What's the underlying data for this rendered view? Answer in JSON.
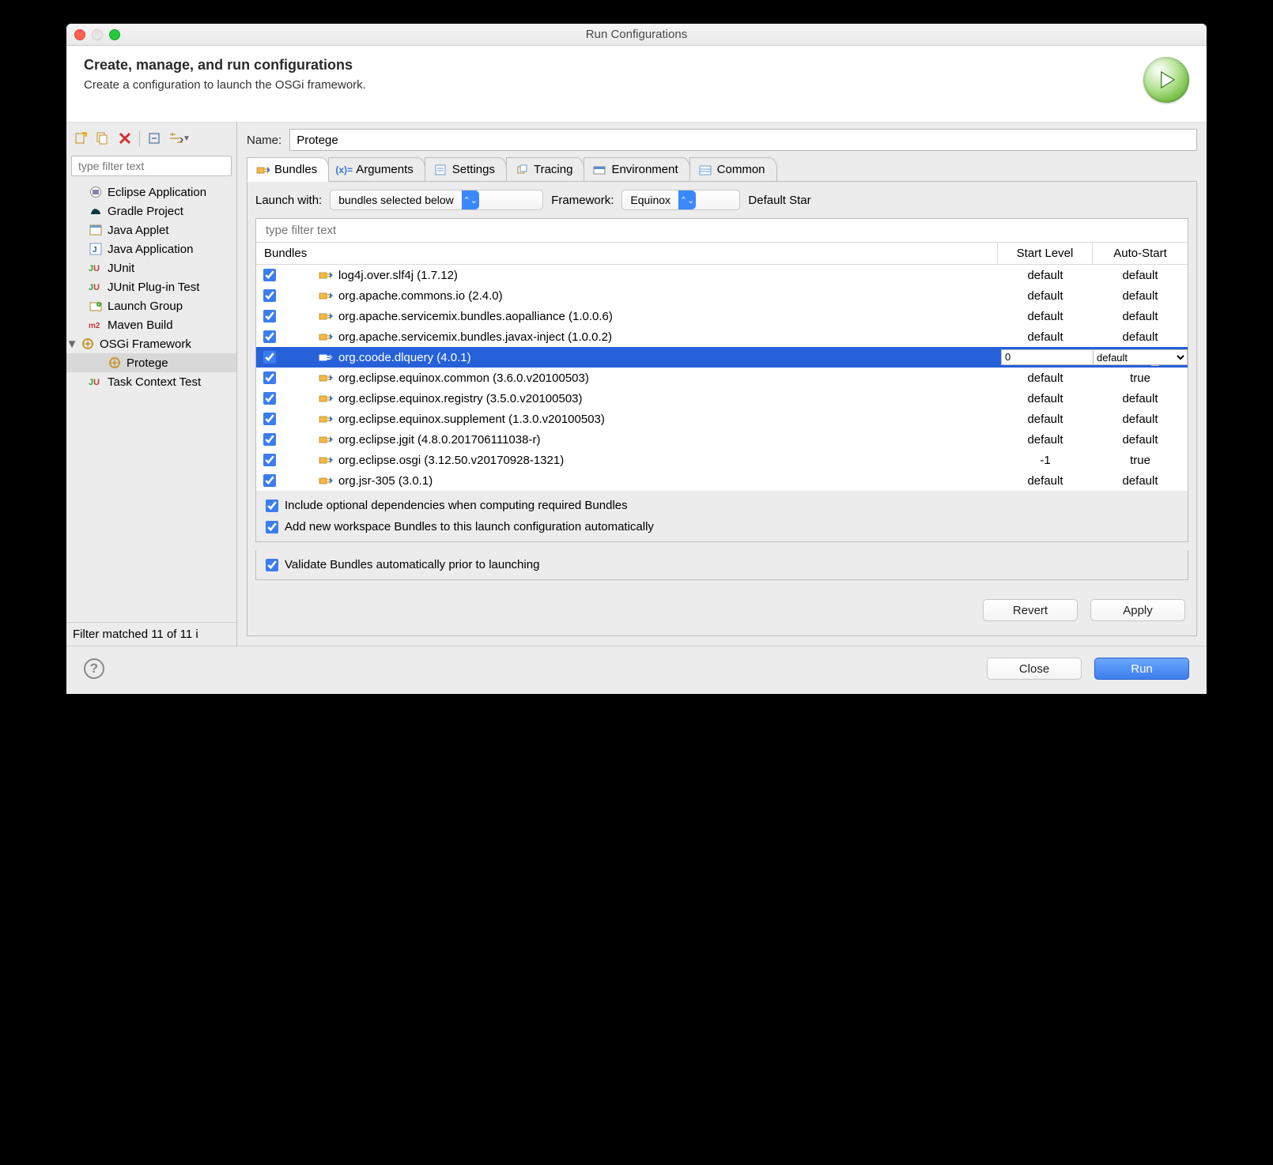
{
  "window": {
    "title": "Run Configurations"
  },
  "header": {
    "title": "Create, manage, and run configurations",
    "subtitle": "Create a configuration to launch the OSGi framework."
  },
  "sidebar": {
    "filter_placeholder": "type filter text",
    "items": [
      {
        "label": "Eclipse Application",
        "icon": "eclipse"
      },
      {
        "label": "Gradle Project",
        "icon": "gradle"
      },
      {
        "label": "Java Applet",
        "icon": "applet"
      },
      {
        "label": "Java Application",
        "icon": "java"
      },
      {
        "label": "JUnit",
        "icon": "junit"
      },
      {
        "label": "JUnit Plug-in Test",
        "icon": "junit"
      },
      {
        "label": "Launch Group",
        "icon": "launch-group"
      },
      {
        "label": "Maven Build",
        "icon": "maven"
      },
      {
        "label": "OSGi Framework",
        "icon": "osgi",
        "expanded": true,
        "children": [
          {
            "label": "Protege",
            "icon": "osgi",
            "selected": true
          }
        ]
      },
      {
        "label": "Task Context Test",
        "icon": "junit"
      }
    ],
    "filter_status": "Filter matched 11 of 11 i"
  },
  "form": {
    "name_label": "Name:",
    "name_value": "Protege"
  },
  "tabs": [
    {
      "label": "Bundles",
      "active": true
    },
    {
      "label": "Arguments"
    },
    {
      "label": "Settings"
    },
    {
      "label": "Tracing"
    },
    {
      "label": "Environment"
    },
    {
      "label": "Common"
    }
  ],
  "launch": {
    "launch_with_label": "Launch with:",
    "launch_with_value": "bundles selected below",
    "framework_label": "Framework:",
    "framework_value": "Equinox",
    "default_start_label": "Default Star"
  },
  "bundle_table": {
    "filter_placeholder": "type filter text",
    "headers": {
      "c1": "Bundles",
      "c2": "Start Level",
      "c3": "Auto-Start"
    },
    "rows": [
      {
        "checked": true,
        "label": "log4j.over.slf4j (1.7.12)",
        "start": "default",
        "auto": "default"
      },
      {
        "checked": true,
        "label": "org.apache.commons.io (2.4.0)",
        "start": "default",
        "auto": "default"
      },
      {
        "checked": true,
        "label": "org.apache.servicemix.bundles.aopalliance (1.0.0.6)",
        "start": "default",
        "auto": "default"
      },
      {
        "checked": true,
        "label": "org.apache.servicemix.bundles.javax-inject (1.0.0.2)",
        "start": "default",
        "auto": "default"
      },
      {
        "checked": true,
        "label": "org.coode.dlquery (4.0.1)",
        "start": "0",
        "auto": "default",
        "selected": true
      },
      {
        "checked": true,
        "label": "org.eclipse.equinox.common (3.6.0.v20100503)",
        "start": "default",
        "auto": "true"
      },
      {
        "checked": true,
        "label": "org.eclipse.equinox.registry (3.5.0.v20100503)",
        "start": "default",
        "auto": "default"
      },
      {
        "checked": true,
        "label": "org.eclipse.equinox.supplement (1.3.0.v20100503)",
        "start": "default",
        "auto": "default"
      },
      {
        "checked": true,
        "label": "org.eclipse.jgit (4.8.0.201706111038-r)",
        "start": "default",
        "auto": "default"
      },
      {
        "checked": true,
        "label": "org.eclipse.osgi (3.12.50.v20170928-1321)",
        "start": "-1",
        "auto": "true"
      },
      {
        "checked": true,
        "label": "org.jsr-305 (3.0.1)",
        "start": "default",
        "auto": "default"
      }
    ]
  },
  "options": {
    "include_optional": "Include optional dependencies when computing required Bundles",
    "add_new_workspace": "Add new workspace Bundles to this launch configuration automatically",
    "validate": "Validate Bundles automatically prior to launching"
  },
  "buttons": {
    "revert": "Revert",
    "apply": "Apply",
    "close": "Close",
    "run": "Run"
  }
}
